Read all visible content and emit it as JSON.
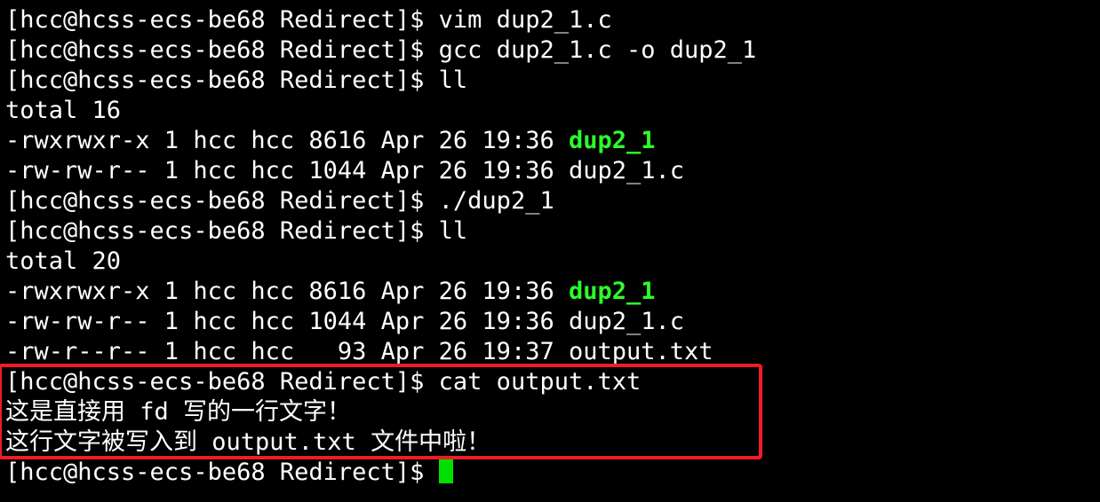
{
  "terminal": {
    "prompt": "[hcc@hcss-ecs-be68 Redirect]$ ",
    "lines": [
      {
        "text": "[hcc@hcss-ecs-be68 Redirect]$ vim dup2_1.c"
      },
      {
        "text": "[hcc@hcss-ecs-be68 Redirect]$ gcc dup2_1.c -o dup2_1"
      },
      {
        "text": "[hcc@hcss-ecs-be68 Redirect]$ ll"
      },
      {
        "text": "total 16"
      },
      {
        "text": "-rwxrwxr-x 1 hcc hcc 8616 Apr 26 19:36 ",
        "exec": "dup2_1"
      },
      {
        "text": "-rw-rw-r-- 1 hcc hcc 1044 Apr 26 19:36 dup2_1.c"
      },
      {
        "text": "[hcc@hcss-ecs-be68 Redirect]$ ./dup2_1"
      },
      {
        "text": "[hcc@hcss-ecs-be68 Redirect]$ ll"
      },
      {
        "text": "total 20"
      },
      {
        "text": "-rwxrwxr-x 1 hcc hcc 8616 Apr 26 19:36 ",
        "exec": "dup2_1"
      },
      {
        "text": "-rw-rw-r-- 1 hcc hcc 1044 Apr 26 19:36 dup2_1.c"
      },
      {
        "text": "-rw-r--r-- 1 hcc hcc   93 Apr 26 19:37 output.txt"
      },
      {
        "text": "[hcc@hcss-ecs-be68 Redirect]$ cat output.txt"
      },
      {
        "text": "这是直接用 fd 写的一行文字！"
      },
      {
        "text": "这行文字被写入到 output.txt 文件中啦！"
      }
    ]
  },
  "colors": {
    "background": "#000000",
    "foreground": "#ffffff",
    "executable": "#2cff2c",
    "cursor": "#00e000",
    "highlight_border": "#ee1c25"
  }
}
